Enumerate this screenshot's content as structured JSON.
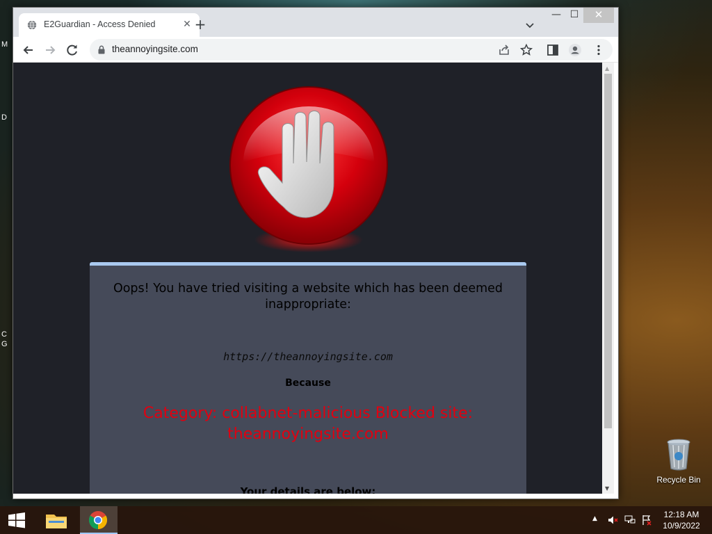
{
  "desktop": {
    "edge_letters": [
      "M",
      "D",
      "C",
      "G"
    ],
    "recycle_bin_label": "Recycle Bin"
  },
  "browser": {
    "tab": {
      "title": "E2Guardian - Access Denied",
      "close_glyph": "✕"
    },
    "new_tab_glyph": "+",
    "window_controls": {
      "minimize": "—",
      "maximize": "☐",
      "close": "✕"
    },
    "address": {
      "url": "theannoyingsite.com"
    }
  },
  "page": {
    "heading": "Oops! You have tried visiting a website which has been deemed inappropriate:",
    "blocked_url": "https://theannoyingsite.com",
    "because_label": "Because",
    "reason": "Category: collabnet-malicious  Blocked site: theannoyingsite.com",
    "details_label": "Your details are below:"
  },
  "taskbar": {
    "time": "12:18 AM",
    "date": "10/9/2022"
  },
  "colors": {
    "page_background": "#1f2128",
    "panel_background": "#454a59",
    "panel_accent": "#a9c9ef",
    "reason_text": "#e10010",
    "stop_sign_red": "#d4000c"
  },
  "icons": [
    "globe-icon",
    "back-arrow-icon",
    "forward-arrow-icon",
    "reload-icon",
    "lock-icon",
    "share-icon",
    "star-icon",
    "sidepanel-icon",
    "profile-icon",
    "menu-kebab-icon",
    "stop-hand-icon",
    "recycle-bin-icon",
    "windows-start-icon",
    "file-explorer-icon",
    "chrome-icon",
    "mute-icon",
    "network-icon",
    "action-center-icon"
  ]
}
